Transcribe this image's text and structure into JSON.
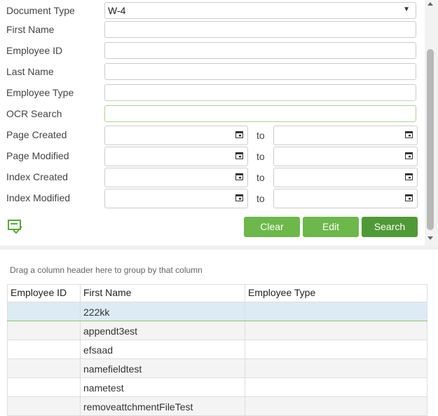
{
  "form": {
    "document_type_label": "Document Type",
    "document_type_value": "W-4",
    "first_name_label": "First Name",
    "employee_id_label": "Employee ID",
    "last_name_label": "Last Name",
    "employee_type_label": "Employee Type",
    "ocr_search_label": "OCR Search",
    "page_created_label": "Page Created",
    "page_modified_label": "Page Modified",
    "index_created_label": "Index Created",
    "index_modified_label": "Index Modified",
    "to_label": "to"
  },
  "buttons": {
    "clear": "Clear",
    "edit": "Edit",
    "search": "Search"
  },
  "grid": {
    "group_hint": "Drag a column header here to group by that column",
    "columns": [
      "Employee ID",
      "First Name",
      "Employee Type"
    ],
    "rows": [
      {
        "employee_id": "",
        "first_name": "222kk",
        "employee_type": ""
      },
      {
        "employee_id": "",
        "first_name": "appendt3est",
        "employee_type": ""
      },
      {
        "employee_id": "",
        "first_name": "efsaad",
        "employee_type": ""
      },
      {
        "employee_id": "",
        "first_name": "namefieldtest",
        "employee_type": ""
      },
      {
        "employee_id": "",
        "first_name": "nametest",
        "employee_type": ""
      },
      {
        "employee_id": "",
        "first_name": "removeattchmentFileTest",
        "employee_type": ""
      }
    ]
  },
  "icons": {
    "saved_search": "checklist-icon",
    "calendar": "calendar-icon",
    "dropdown": "caret-down-icon"
  },
  "colors": {
    "button_green": "#6cb84b",
    "button_green_dark": "#4f9a36",
    "selected_row": "#dcebf4"
  }
}
